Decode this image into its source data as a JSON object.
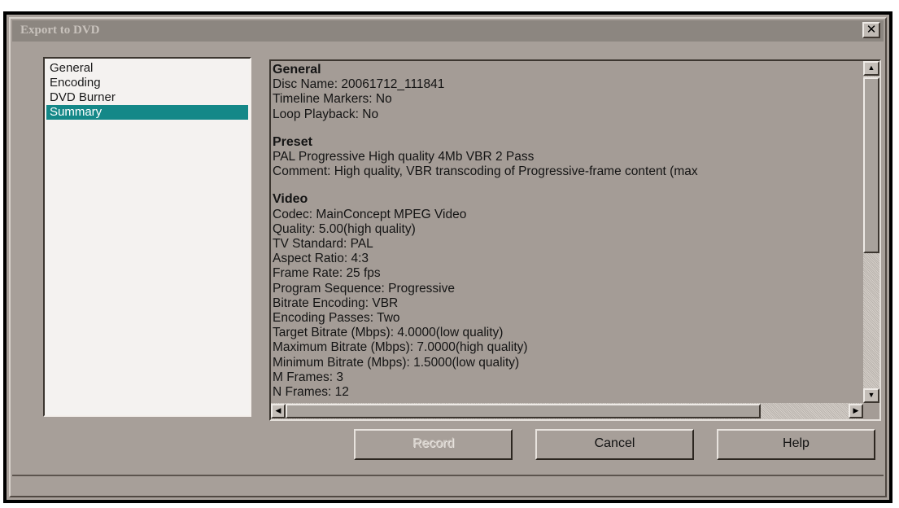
{
  "window": {
    "title": "Export to DVD",
    "close_glyph": "✕"
  },
  "nav": {
    "items": [
      {
        "label": "General",
        "selected": false
      },
      {
        "label": "Encoding",
        "selected": false
      },
      {
        "label": "DVD Burner",
        "selected": false
      },
      {
        "label": "Summary",
        "selected": true
      }
    ]
  },
  "summary": {
    "lines": [
      {
        "text": "General",
        "heading": true
      },
      {
        "text": "Disc Name: 20061712_111841"
      },
      {
        "text": "Timeline Markers: No"
      },
      {
        "text": "Loop Playback: No"
      },
      {
        "spacer": true
      },
      {
        "text": "Preset",
        "heading": true
      },
      {
        "text": "PAL Progressive High quality 4Mb VBR 2 Pass"
      },
      {
        "text": "Comment: High quality, VBR transcoding of Progressive-frame content (max"
      },
      {
        "spacer": true
      },
      {
        "text": "Video",
        "heading": true
      },
      {
        "text": "Codec: MainConcept MPEG Video"
      },
      {
        "text": "Quality: 5.00(high quality)"
      },
      {
        "text": "TV Standard: PAL"
      },
      {
        "text": "Aspect Ratio: 4:3"
      },
      {
        "text": "Frame Rate: 25 fps"
      },
      {
        "text": "Program Sequence: Progressive"
      },
      {
        "text": "Bitrate Encoding: VBR"
      },
      {
        "text": "Encoding Passes: Two"
      },
      {
        "text": "Target Bitrate (Mbps): 4.0000(low quality)"
      },
      {
        "text": "Maximum Bitrate (Mbps): 7.0000(high quality)"
      },
      {
        "text": "Minimum Bitrate (Mbps): 1.5000(low quality)"
      },
      {
        "text": "M Frames: 3"
      },
      {
        "text": "N Frames: 12"
      }
    ]
  },
  "scrollbars": {
    "up_glyph": "▲",
    "down_glyph": "▼",
    "left_glyph": "◀",
    "right_glyph": "▶"
  },
  "buttons": {
    "record": "Record",
    "cancel": "Cancel",
    "help": "Help"
  },
  "colors": {
    "selection": "#148888",
    "dialog_bg": "#a79f99"
  }
}
